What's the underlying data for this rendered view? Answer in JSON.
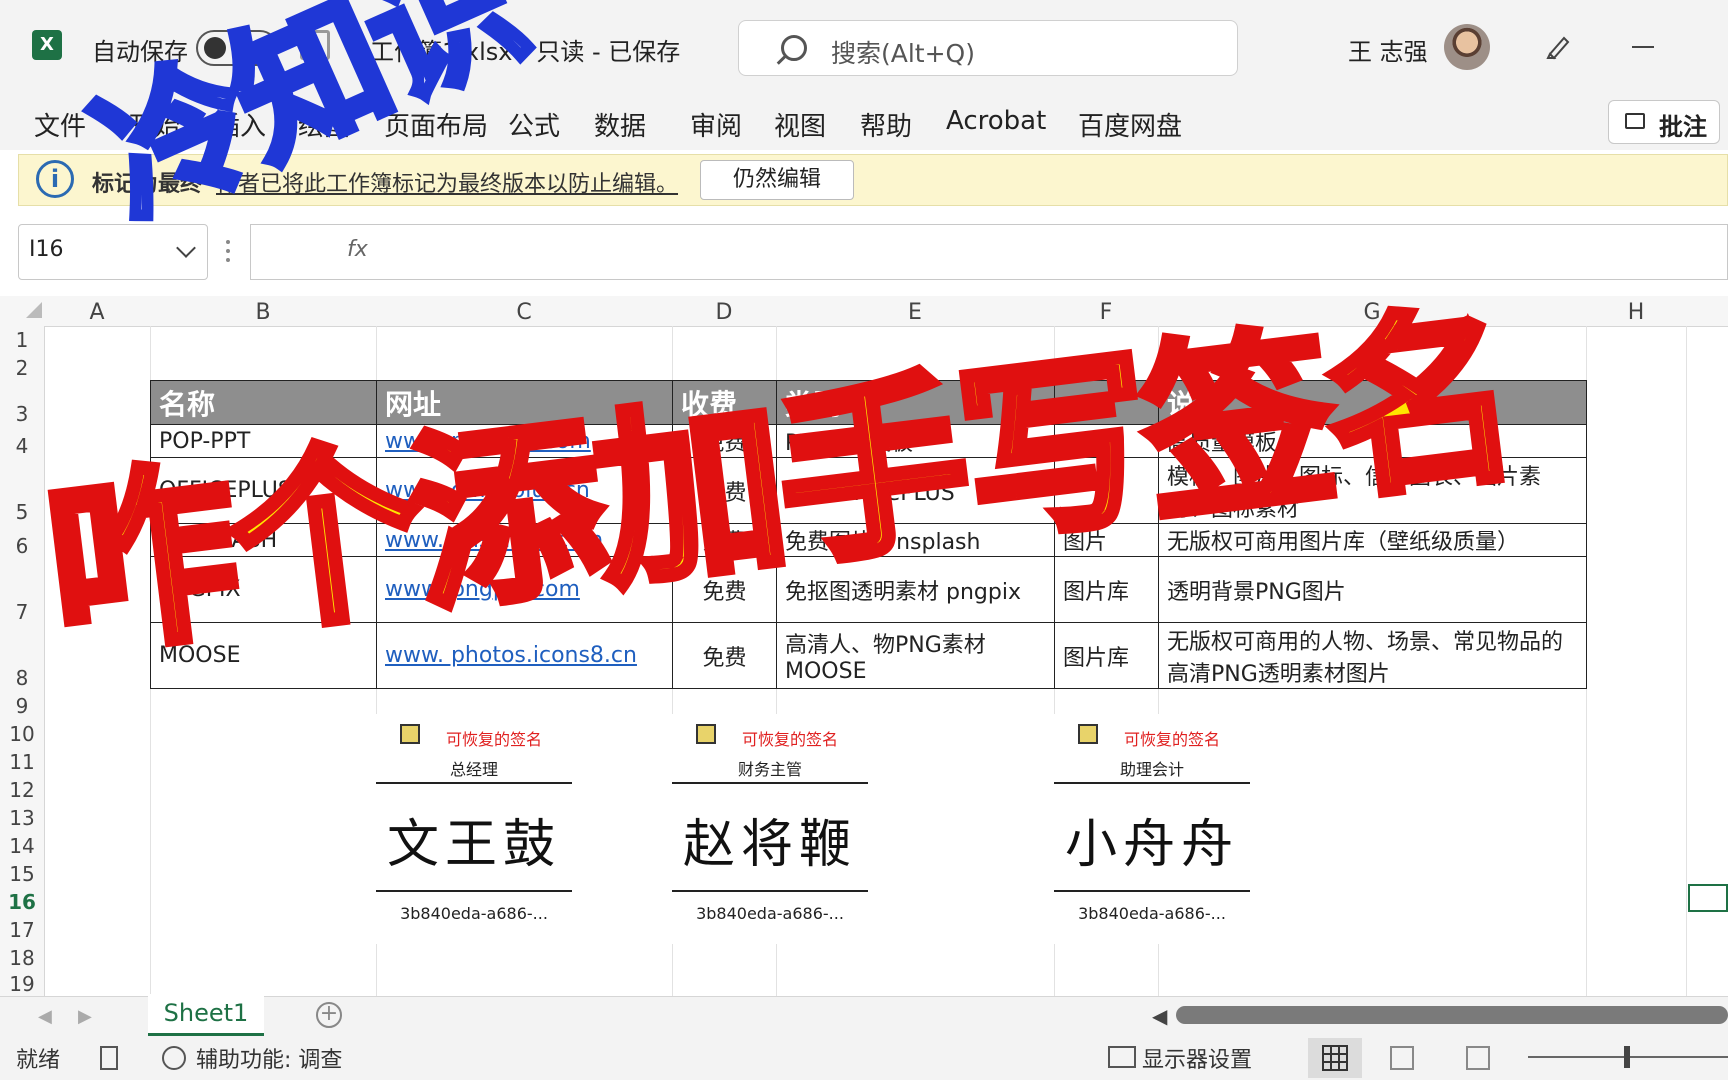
{
  "titlebar": {
    "autosave_label": "自动保存",
    "autosave_state": "关",
    "filename": "工作簿1.xlsx  -  只读  -  已保存",
    "search_placeholder": "搜索(Alt+Q)",
    "user_name": "王 志强"
  },
  "ribbon": {
    "tabs": [
      "文件",
      "开始",
      "插入",
      "绘图",
      "页面布局",
      "公式",
      "数据",
      "审阅",
      "视图",
      "帮助",
      "Acrobat",
      "百度网盘"
    ],
    "comment_label": "批注"
  },
  "infobar": {
    "title": "标记为最终",
    "message": "作者已将此工作簿标记为最终版本以防止编辑。",
    "edit_button": "仍然编辑"
  },
  "formula_bar": {
    "cell_ref": "I16",
    "fx": "fx"
  },
  "columns": [
    "A",
    "B",
    "C",
    "D",
    "E",
    "F",
    "G",
    "H"
  ],
  "rows": [
    "1",
    "2",
    "3",
    "4",
    "5",
    "6",
    "7",
    "8",
    "9",
    "10",
    "11",
    "12",
    "13",
    "14",
    "15",
    "16",
    "17",
    "18",
    "19"
  ],
  "table": {
    "headers": [
      "名称",
      "网址",
      "收费",
      "类别",
      "",
      "说明"
    ],
    "rows": [
      [
        "POP-PPT",
        "www. pop-ppt.com",
        "免费",
        "PPT素材模板",
        "",
        "高质量模板"
      ],
      [
        "OFFICEPLUS",
        "www. officeplus.cn",
        "免费",
        "微软 OfficePLUS",
        "",
        "模板、图片、图标、信息图表、图片素材、图标素材"
      ],
      [
        "UNSPLASH",
        "www. unsplash.com",
        "免费",
        "免费图片 Unsplash",
        "图片",
        "无版权可商用图片库（壁纸级质量）"
      ],
      [
        "PNGPIX",
        "www. pngpix.com",
        "免费",
        "免抠图透明素材 pngpix",
        "图片库",
        "透明背景PNG图片"
      ],
      [
        "MOOSE",
        "www. photos.icons8.cn",
        "免费",
        "高清人、物PNG素材 MOOSE",
        "图片库",
        "无版权可商用的人物、场景、常见物品的高清PNG透明素材图片"
      ]
    ]
  },
  "signatures": [
    {
      "label": "可恢复的签名",
      "role": "总经理",
      "name": "文王鼓",
      "id": "3b840eda-a686-..."
    },
    {
      "label": "可恢复的签名",
      "role": "财务主管",
      "name": "赵将鞭",
      "id": "3b840eda-a686-..."
    },
    {
      "label": "可恢复的签名",
      "role": "助理会计",
      "name": "小舟舟",
      "id": "3b840eda-a686-..."
    }
  ],
  "sheet_tab": "Sheet1",
  "statusbar": {
    "ready": "就绪",
    "accessibility": "辅助功能: 调查",
    "display_settings": "显示器设置"
  },
  "overlay": {
    "top": "冷知识",
    "main": "咋个添加手写签名"
  },
  "colors": {
    "excel_green": "#1e7145",
    "infobar": "#fcf6cf",
    "header_gray": "#8e8e8e",
    "overlay_yellow": "#ffe600",
    "overlay_red": "#e01010",
    "overlay_blue": "#1f37d6"
  }
}
